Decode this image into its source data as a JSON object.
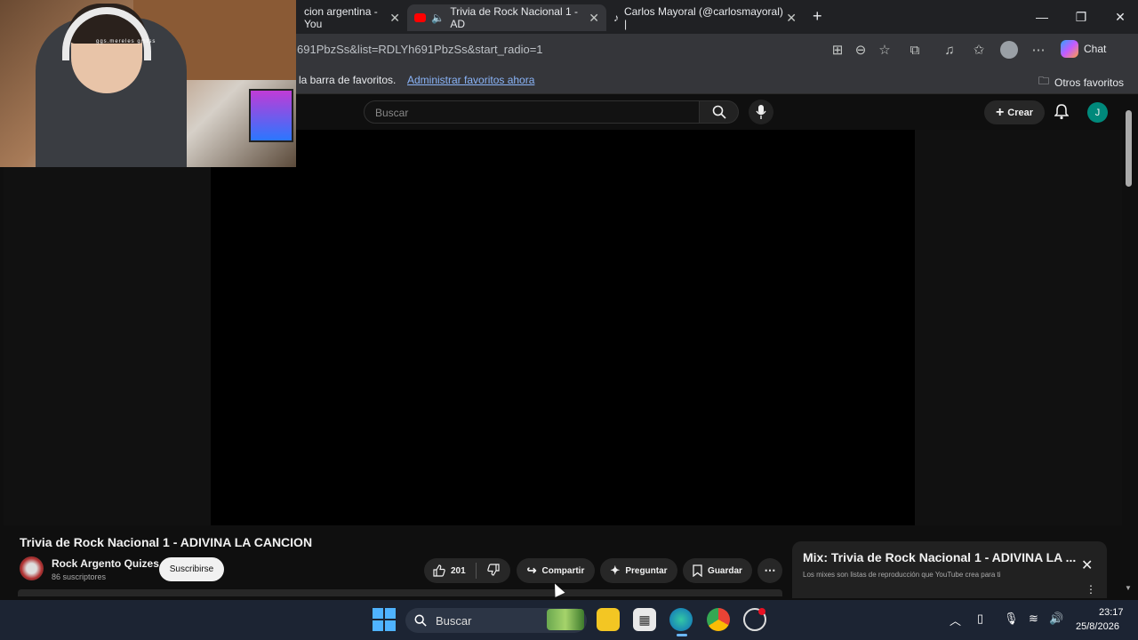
{
  "tabs": [
    {
      "label": "cion argentina - You",
      "icon": "youtube-icon"
    },
    {
      "label": "Trivia de Rock Nacional 1 - AD",
      "icon": "youtube-icon",
      "audio": true
    },
    {
      "label": "Carlos Mayoral (@carlosmayoral) |",
      "icon": "tiktok-icon"
    }
  ],
  "address": {
    "url": "691PbzSs&list=RDLYh691PbzSs&start_radio=1"
  },
  "toolbar": {
    "chat_label": "Chat"
  },
  "favorites": {
    "text": "la barra de favoritos.",
    "link": "Administrar favoritos ahora",
    "other": "Otros favoritos"
  },
  "yt": {
    "search_placeholder": "Buscar",
    "create_label": "Crear",
    "avatar_letter": "J"
  },
  "webcam": {
    "overlay_text": "ggs.mereles gmtss"
  },
  "video": {
    "title": "Trivia de Rock Nacional 1 - ADIVINA LA CANCION",
    "channel": "Rock Argento Quizes",
    "subscribers": "86 suscriptores",
    "subscribe_label": "Suscribirse",
    "likes": "201",
    "share_label": "Compartir",
    "ask_label": "Preguntar",
    "save_label": "Guardar"
  },
  "mix": {
    "title": "Mix: Trivia de Rock Nacional 1 - ADIVINA LA ...",
    "subtitle": "Los mixes son listas de reproducción que YouTube crea para ti"
  },
  "taskbar": {
    "search_label": "Buscar",
    "time": "23:17",
    "date": "25/8/2026"
  },
  "colors": {
    "youtube_bg": "#0f0f0f",
    "chrome_bg": "#35363a",
    "link": "#8ab4f8",
    "taskbar": "#1c2433"
  }
}
